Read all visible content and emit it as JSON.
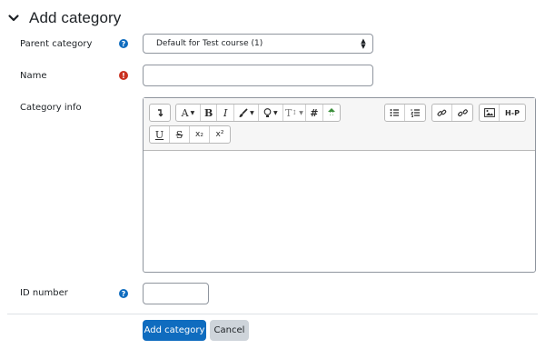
{
  "section": {
    "title": "Add category",
    "chevron_icon": "chevron-down-icon"
  },
  "form": {
    "parent_category": {
      "label": "Parent category",
      "value": "Default for Test course (1)",
      "help_icon": "question-circle-icon"
    },
    "name": {
      "label": "Name",
      "value": "",
      "required_icon": "exclamation-circle-icon"
    },
    "category_info": {
      "label": "Category info",
      "toolbar": {
        "row1": [
          {
            "name": "collapse-icon",
            "text": ""
          },
          {
            "name": "font-size-icon",
            "text": "A"
          },
          {
            "name": "bold-icon",
            "text": "B"
          },
          {
            "name": "italic-icon",
            "text": "I"
          },
          {
            "name": "brush-icon",
            "text": ""
          },
          {
            "name": "lightbulb-icon",
            "text": ""
          },
          {
            "name": "text-format-icon",
            "text": "T"
          },
          {
            "name": "hash-icon",
            "text": "#"
          },
          {
            "name": "recycle-icon",
            "text": ""
          },
          {
            "name": "unordered-list-icon",
            "text": ""
          },
          {
            "name": "ordered-list-icon",
            "text": ""
          },
          {
            "name": "link-icon",
            "text": ""
          },
          {
            "name": "unlink-icon",
            "text": ""
          },
          {
            "name": "image-icon",
            "text": ""
          },
          {
            "name": "h5p-icon",
            "text": "H-P"
          }
        ],
        "row2": [
          {
            "name": "underline-icon",
            "text": "U"
          },
          {
            "name": "strikethrough-icon",
            "text": "S"
          },
          {
            "name": "subscript-icon",
            "text": "x₂"
          },
          {
            "name": "superscript-icon",
            "text": "x²"
          }
        ]
      },
      "content": ""
    },
    "id_number": {
      "label": "ID number",
      "value": "",
      "help_icon": "question-circle-icon"
    }
  },
  "actions": {
    "submit_label": "Add category",
    "cancel_label": "Cancel"
  },
  "colors": {
    "primary": "#0f6cbf",
    "danger": "#ca3120",
    "secondary": "#ced4da"
  }
}
